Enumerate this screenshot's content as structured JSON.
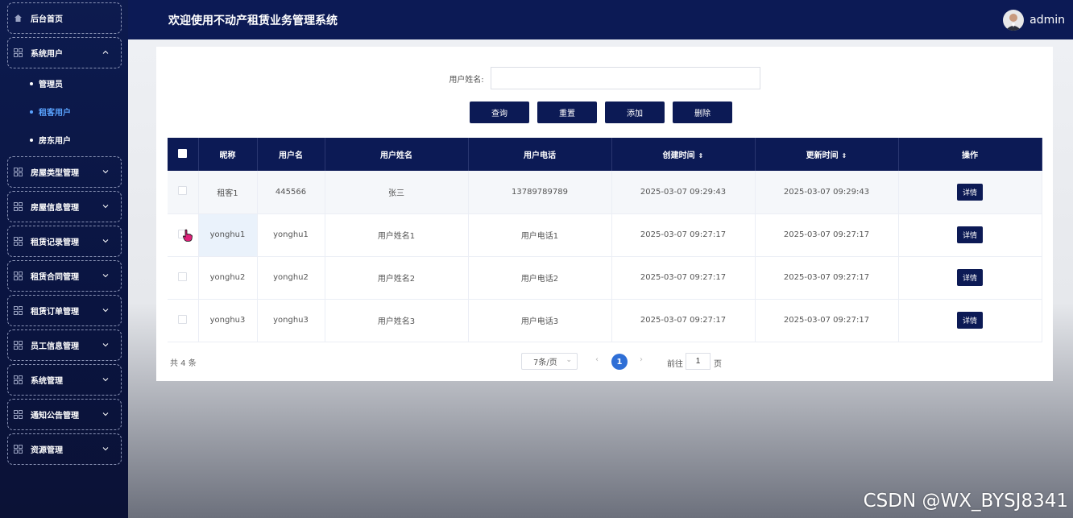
{
  "header": {
    "title": "欢迎使用不动产租赁业务管理系统",
    "username": "admin"
  },
  "sidebar": {
    "home": "后台首页",
    "system_users": "系统用户",
    "sub_items": [
      "管理员",
      "租客用户",
      "房东用户"
    ],
    "menus": [
      "房屋类型管理",
      "房屋信息管理",
      "租赁记录管理",
      "租赁合同管理",
      "租赁订单管理",
      "员工信息管理",
      "系统管理",
      "通知公告管理",
      "资源管理"
    ]
  },
  "search": {
    "label": "用户姓名:",
    "value": ""
  },
  "buttons": {
    "query": "查询",
    "reset": "重置",
    "add": "添加",
    "delete": "删除"
  },
  "table": {
    "headers": [
      "昵称",
      "用户名",
      "用户姓名",
      "用户电话",
      "创建时间",
      "更新时间",
      "操作"
    ],
    "sort_icon": "⇕",
    "detail_label": "详情",
    "rows": [
      [
        "租客1",
        "445566",
        "张三",
        "13789789789",
        "2025-03-07 09:29:43",
        "2025-03-07 09:29:43"
      ],
      [
        "yonghu1",
        "yonghu1",
        "用户姓名1",
        "用户电话1",
        "2025-03-07 09:27:17",
        "2025-03-07 09:27:17"
      ],
      [
        "yonghu2",
        "yonghu2",
        "用户姓名2",
        "用户电话2",
        "2025-03-07 09:27:17",
        "2025-03-07 09:27:17"
      ],
      [
        "yonghu3",
        "yonghu3",
        "用户姓名3",
        "用户电话3",
        "2025-03-07 09:27:17",
        "2025-03-07 09:27:17"
      ]
    ]
  },
  "pagination": {
    "total": "共 4 条",
    "page_size": "7条/页",
    "current_page": "1",
    "goto_label": "前往",
    "goto_value": "1",
    "goto_suffix": "页"
  },
  "watermark": "CSDN @WX_BYSJ8341",
  "colors": {
    "navy": "#0c1a55",
    "active_sub": "#5aa3ff",
    "page_active": "#2f6fd6"
  }
}
